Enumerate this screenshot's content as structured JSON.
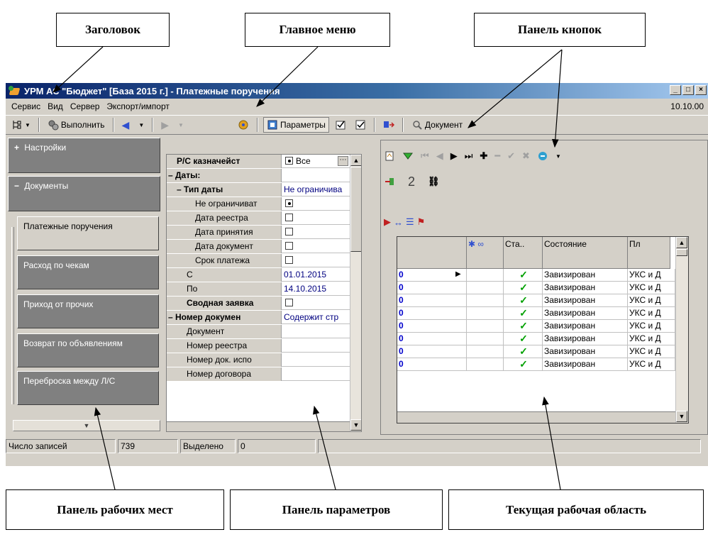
{
  "callouts": {
    "title": "Заголовок",
    "main_menu": "Главное меню",
    "button_panel": "Панель кнопок",
    "workplace_panel": "Панель рабочих мест",
    "params_panel": "Панель параметров",
    "work_area": "Текущая рабочая область"
  },
  "window": {
    "title": "УРМ АС \"Бюджет\" [База 2015 г.] - Платежные поручения",
    "minimize": "_",
    "maximize": "□",
    "close": "×"
  },
  "menu": {
    "items": [
      "Сервис",
      "Вид",
      "Сервер",
      "Экспорт/импорт"
    ],
    "date": "10.10.00"
  },
  "toolbar": {
    "run_label": "Выполнить",
    "params_label": "Параметры",
    "document_label": "Документ"
  },
  "left_panel": {
    "groups": [
      {
        "sign": "+",
        "label": "Настройки"
      },
      {
        "sign": "−",
        "label": "Документы"
      }
    ],
    "workplaces": [
      "Платежные поручения",
      "Расход по чекам",
      "Приход от прочих",
      "Возврат по объявлениям",
      "Переброска между Л/С"
    ],
    "scroll_down": "▼"
  },
  "params": {
    "rows": [
      {
        "name": "Р/С казначейст",
        "bold": true,
        "indent": 14,
        "value": "Все",
        "type": "radio-ellipsis"
      },
      {
        "name": "– Даты:",
        "bold": true,
        "indent": 2,
        "value": "",
        "type": "none"
      },
      {
        "name": "– Тип даты",
        "bold": true,
        "indent": 14,
        "value": "Не ограничива",
        "type": "text"
      },
      {
        "name": "Не ограничиват",
        "bold": false,
        "indent": 40,
        "value": "",
        "type": "radio"
      },
      {
        "name": "Дата реестра",
        "bold": false,
        "indent": 40,
        "value": "",
        "type": "check"
      },
      {
        "name": "Дата принятия",
        "bold": false,
        "indent": 40,
        "value": "",
        "type": "check"
      },
      {
        "name": "Дата документ",
        "bold": false,
        "indent": 40,
        "value": "",
        "type": "check"
      },
      {
        "name": "Срок платежа",
        "bold": false,
        "indent": 40,
        "value": "",
        "type": "check"
      },
      {
        "name": "С",
        "bold": false,
        "indent": 28,
        "value": "01.01.2015",
        "type": "text"
      },
      {
        "name": "По",
        "bold": false,
        "indent": 28,
        "value": "14.10.2015",
        "type": "text"
      },
      {
        "name": "Сводная заявка",
        "bold": true,
        "indent": 28,
        "value": "",
        "type": "check"
      },
      {
        "name": "– Номер докумен",
        "bold": true,
        "indent": 2,
        "value": "Содержит стр",
        "type": "text"
      },
      {
        "name": "Документ",
        "bold": false,
        "indent": 28,
        "value": "",
        "type": "none"
      },
      {
        "name": "Номер реестра",
        "bold": false,
        "indent": 28,
        "value": "",
        "type": "none"
      },
      {
        "name": "Номер док. испо",
        "bold": false,
        "indent": 28,
        "value": "",
        "type": "none"
      },
      {
        "name": "Номер договора",
        "bold": false,
        "indent": 28,
        "value": "",
        "type": "none"
      }
    ]
  },
  "workarea": {
    "toolbar2_page": "2",
    "grid_headers": [
      "",
      "",
      "Ста..",
      "Состояние",
      "Пл"
    ],
    "rows": [
      {
        "mark": "0",
        "state": "Завизирован",
        "payer": "УКС и Д"
      },
      {
        "mark": "0",
        "state": "Завизирован",
        "payer": "УКС и Д"
      },
      {
        "mark": "0",
        "state": "Завизирован",
        "payer": "УКС и Д"
      },
      {
        "mark": "0",
        "state": "Завизирован",
        "payer": "УКС и Д"
      },
      {
        "mark": "0",
        "state": "Завизирован",
        "payer": "УКС и Д"
      },
      {
        "mark": "0",
        "state": "Завизирован",
        "payer": "УКС и Д"
      },
      {
        "mark": "0",
        "state": "Завизирован",
        "payer": "УКС и Д"
      },
      {
        "mark": "0",
        "state": "Завизирован",
        "payer": "УКС и Д"
      }
    ],
    "check_glyph": "✓"
  },
  "status": {
    "records_label": "Число записей",
    "records_value": "739",
    "selected_label": "Выделено",
    "selected_value": "0"
  }
}
